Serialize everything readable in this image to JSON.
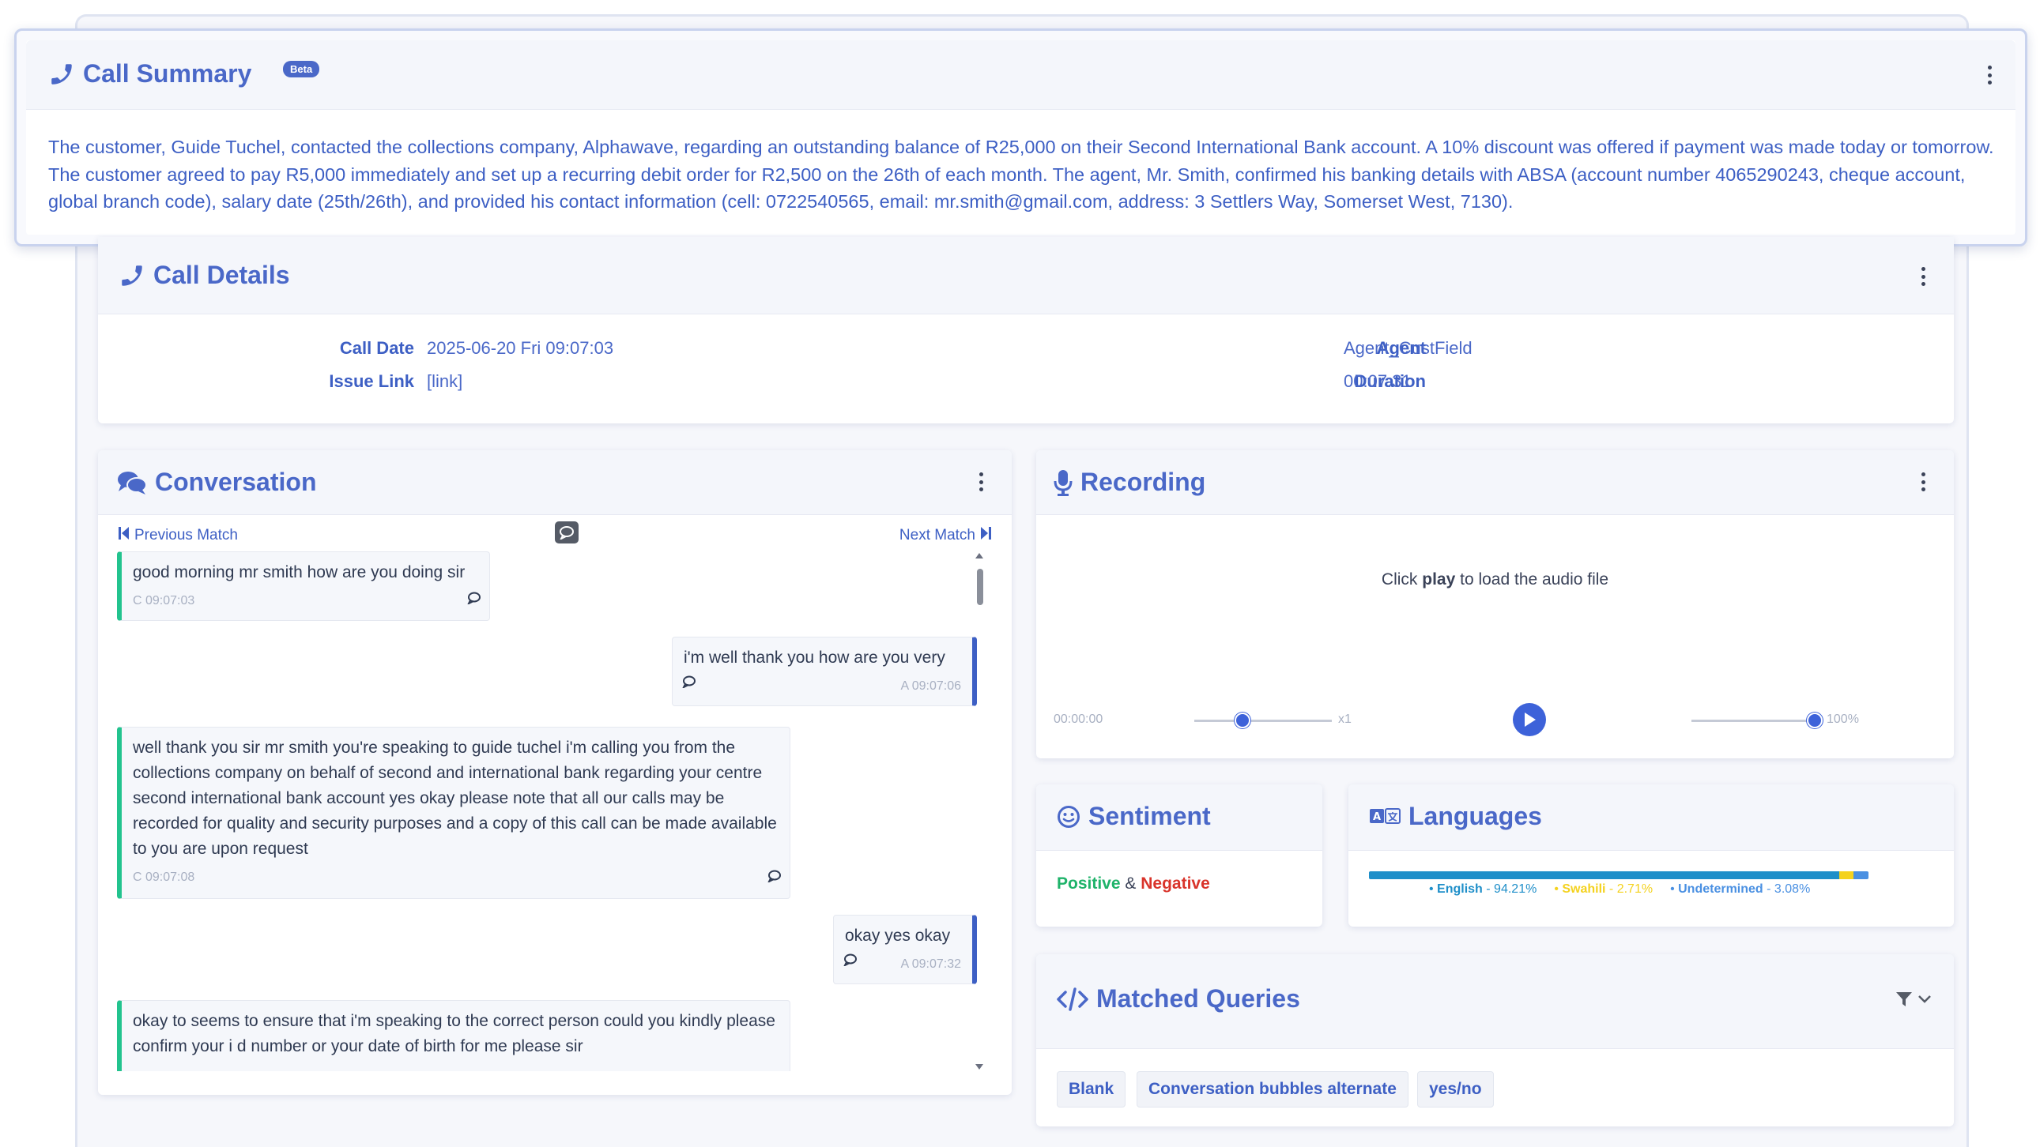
{
  "summary": {
    "title": "Call Summary",
    "badge": "Beta",
    "text": "The customer, Guide Tuchel, contacted the collections company, Alphawave, regarding an outstanding balance of R25,000 on their Second International Bank account. A 10% discount was offered if payment was made today or tomorrow. The customer agreed to pay R5,000 immediately and set up a recurring debit order for R2,500 on the 26th of each month. The agent, Mr. Smith, confirmed his banking details with ABSA (account number 4065290243, cheque account, global branch code), salary date (25th/26th), and provided his contact information (cell: 0722540565, email: mr.smith@gmail.com, address: 3 Settlers Way, Somerset West, 7130)."
  },
  "details": {
    "title": "Call Details",
    "call_date_label": "Call Date",
    "call_date": "2025-06-20 Fri 09:07:03",
    "issue_link_label": "Issue Link",
    "issue_link": "[link]",
    "agent_label": "Agent",
    "agent": "Agent_CustField",
    "duration_label": "Duration",
    "duration": "00:07:31"
  },
  "conversation": {
    "title": "Conversation",
    "prev_match": "Previous Match",
    "next_match": "Next Match",
    "messages": [
      {
        "side": "C",
        "text": "good morning mr smith how are you doing sir",
        "time": "C 09:07:03"
      },
      {
        "side": "A",
        "text": "i'm well thank you how are you very",
        "time": "A 09:07:06"
      },
      {
        "side": "C",
        "text": "well thank you sir mr smith you're speaking to guide tuchel i'm calling you from the collections company on behalf of second and international bank regarding your centre second international bank account yes okay please note that all our calls may be recorded for quality and security purposes and a copy of this call can be made available to you are upon request",
        "time": "C 09:07:08"
      },
      {
        "side": "A",
        "text": "okay yes okay",
        "time": "A 09:07:32"
      },
      {
        "side": "C",
        "text": "okay to seems to ensure that i'm speaking to the correct person could you kindly please confirm your i d number or your date of birth for me please sir",
        "time": ""
      }
    ]
  },
  "recording": {
    "title": "Recording",
    "note_prefix": "Click ",
    "note_bold": "play",
    "note_suffix": " to load the audio file",
    "time": "00:00:00",
    "speed": "x1",
    "speed_level": 0.35,
    "volume": "100%",
    "volume_level": 0.95
  },
  "sentiment": {
    "title": "Sentiment",
    "positive": "Positive",
    "amp": " & ",
    "negative": "Negative"
  },
  "languages": {
    "title": "Languages",
    "items": [
      {
        "name": "English",
        "pct": "94.21%",
        "value": 94.21,
        "color": "#1f8fc9"
      },
      {
        "name": "Swahili",
        "pct": "2.71%",
        "value": 2.71,
        "color": "#f4d21f"
      },
      {
        "name": "Undetermined",
        "pct": "3.08%",
        "value": 3.08,
        "color": "#4a90e2"
      }
    ],
    "sep": " - "
  },
  "matched": {
    "title": "Matched Queries",
    "tags": [
      "Blank",
      "Conversation bubbles alternate",
      "yes/no"
    ]
  },
  "colors": {
    "accent": "#4a68c8",
    "positive": "#1fb36a",
    "negative": "#d9342b",
    "customer": "#22c38e"
  }
}
